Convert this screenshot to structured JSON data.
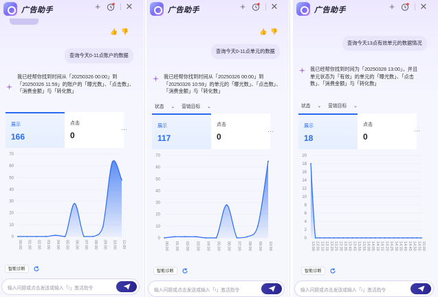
{
  "app": {
    "title": "广告助手"
  },
  "colors": {
    "accent": "#2a6bf2",
    "send": "#2f2b9c",
    "bubble": "#e9e5fb"
  },
  "common": {
    "feedback_icons": [
      "thumbs-up-icon",
      "thumbs-down-icon"
    ],
    "filter_status": "状态",
    "filter_objective": "营销目标",
    "metric_impressions": "展示",
    "metric_clicks": "点击",
    "more": "···",
    "diagnose_button": "智能诊断",
    "input_placeholder": "输入问题或点击发送或输入「/」激活指令"
  },
  "panels": [
    {
      "user_query": "查询今天0-11点账户的数据",
      "reply": "我已经帮你找到时间从「20250326 00:00」到「20250326 11:59」的账户的「曝光数」、「点击数」、「消费金额」与「转化数」",
      "impressions": "166",
      "clicks": "0",
      "chart_data": {
        "type": "area",
        "x": [
          "00:00",
          "01:00",
          "02:00",
          "03:00",
          "04:00",
          "05:00",
          "06:00",
          "07:00",
          "08:00",
          "09:00",
          "10:00",
          "11:00"
        ],
        "values": [
          0,
          0,
          0,
          0,
          1,
          0,
          28,
          0,
          0,
          8,
          63,
          48
        ],
        "yticks": [
          0,
          10,
          20,
          30,
          40,
          50,
          60,
          70
        ],
        "ylim": [
          0,
          70
        ],
        "color": "#2a6bf2"
      }
    },
    {
      "user_query": "查询今天0-11点单元的数据",
      "reply": "我已经帮你找到时间从「20250326 00:00」到「20250326 10:59」的单元的「曝光数」、「点击数」、「消费金额」与「转化数」",
      "impressions": "117",
      "clicks": "0",
      "chart_data": {
        "type": "area",
        "x": [
          "00:00",
          "01:00",
          "02:00",
          "03:00",
          "04:00",
          "05:00",
          "06:00",
          "07:00",
          "08:00",
          "09:00",
          "10:00"
        ],
        "values": [
          0,
          1,
          1,
          1,
          0,
          0,
          28,
          0,
          1,
          10,
          65
        ],
        "yticks": [
          0,
          10,
          20,
          30,
          40,
          50,
          60,
          70
        ],
        "ylim": [
          0,
          70
        ],
        "color": "#2a6bf2"
      }
    },
    {
      "user_query": "查询今天13点有效单元的数据情况",
      "reply": "我已经帮你找到时间为「20250328 13:00」，并且单元状态为「有效」的单元的「曝光数」、「点击数」、「消费金额」与「转化数」",
      "impressions": "18",
      "clicks": "0",
      "chart_data": {
        "type": "area",
        "x": [
          "13:00",
          "13:05",
          "13:10",
          "13:15",
          "13:20",
          "13:25",
          "13:30",
          "13:35",
          "13:40",
          "13:45",
          "13:50",
          "13:55",
          "14:00",
          "14:05",
          "14:10",
          "14:15",
          "14:20",
          "14:25",
          "14:30",
          "14:35",
          "14:40",
          "14:45",
          "14:50",
          "14:55",
          "15:00"
        ],
        "values": [
          18,
          0,
          0,
          0,
          0,
          0,
          0,
          0,
          0,
          0,
          0,
          0,
          0,
          0,
          0,
          0,
          0,
          0,
          0,
          0,
          0,
          0,
          0,
          0,
          0
        ],
        "yticks": [
          0,
          2,
          4,
          6,
          8,
          10,
          12,
          14,
          16,
          18,
          20
        ],
        "ylim": [
          0,
          20
        ],
        "color": "#2a6bf2"
      }
    }
  ]
}
